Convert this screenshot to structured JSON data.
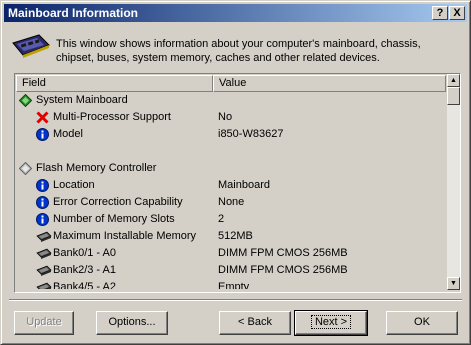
{
  "window": {
    "title": "Mainboard Information"
  },
  "title_buttons": {
    "help": "?",
    "close": "X"
  },
  "description": "This window shows information about your computer's mainboard, chassis, chipset, buses, system memory, caches and other related devices.",
  "list": {
    "columns": {
      "field": "Field",
      "value": "Value"
    },
    "rows": [
      {
        "type": "group",
        "icon": "green-diamond-icon",
        "field": "System Mainboard",
        "value": ""
      },
      {
        "type": "item",
        "icon": "red-x-icon",
        "field": "Multi-Processor Support",
        "value": "No"
      },
      {
        "type": "item",
        "icon": "info-icon",
        "field": "Model",
        "value": "i850-W83627"
      },
      {
        "type": "blank",
        "field": "",
        "value": ""
      },
      {
        "type": "group",
        "icon": "gray-diamond-icon",
        "field": "Flash Memory Controller",
        "value": ""
      },
      {
        "type": "item",
        "icon": "info-icon",
        "field": "Location",
        "value": "Mainboard"
      },
      {
        "type": "item",
        "icon": "info-icon",
        "field": "Error Correction Capability",
        "value": "None"
      },
      {
        "type": "item",
        "icon": "info-icon",
        "field": "Number of Memory Slots",
        "value": "2"
      },
      {
        "type": "item",
        "icon": "memory-chip-icon",
        "field": "Maximum Installable Memory",
        "value": "512MB"
      },
      {
        "type": "item",
        "icon": "memory-chip-icon",
        "field": "Bank0/1 - A0",
        "value": "DIMM FPM CMOS 256MB"
      },
      {
        "type": "item",
        "icon": "memory-chip-icon",
        "field": "Bank2/3 - A1",
        "value": "DIMM FPM CMOS 256MB"
      },
      {
        "type": "item",
        "icon": "memory-chip-icon",
        "field": "Bank4/5 - A2",
        "value": "Empty"
      }
    ]
  },
  "buttons": {
    "update": "Update",
    "options": "Options...",
    "back": "< Back",
    "next": "Next >",
    "ok": "OK"
  },
  "colors": {
    "title_start": "#0a246a",
    "title_end": "#a6caf0",
    "face": "#d4d0c8"
  }
}
